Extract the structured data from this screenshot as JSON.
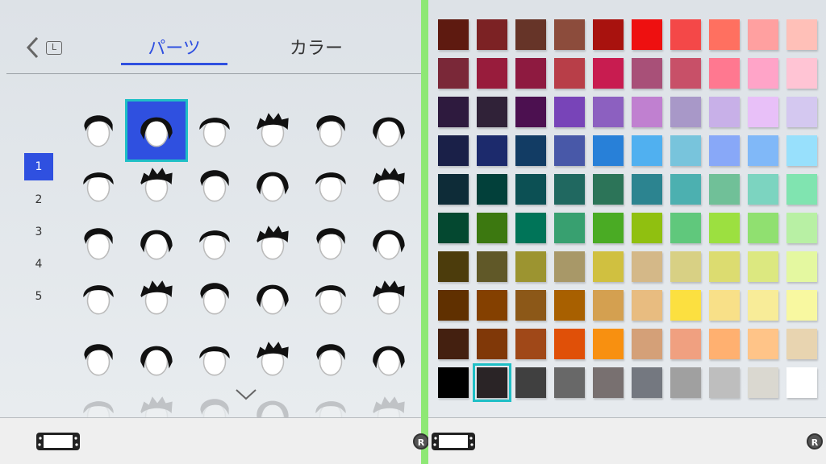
{
  "header": {
    "back_label": "L",
    "tabs": [
      {
        "label": "パーツ",
        "active": true
      },
      {
        "label": "カラー",
        "active": false
      }
    ]
  },
  "pages": {
    "items": [
      "1",
      "2",
      "3",
      "4",
      "5"
    ],
    "active": "1"
  },
  "hairstyles": {
    "selected_index": 1,
    "styles": [
      "short-bowl",
      "bob-selected",
      "short-crop",
      "spiky-short",
      "spiky-long",
      "swept",
      "side-part-left",
      "side-part-small",
      "side-part-right",
      "swoop-right",
      "middle-part",
      "widow-peak",
      "flat-top",
      "long-bob",
      "pompadour",
      "spiky-top",
      "swept-back",
      "messy-spiky",
      "curly-short",
      "curly-volume",
      "curly-side",
      "curly-top",
      "curly-wide",
      "curly-round",
      "afro-spiky",
      "long-side",
      "long-straight",
      "spiky-mid",
      "long-middle",
      "long-round"
    ]
  },
  "palette": {
    "selected_row": 9,
    "selected_col": 1,
    "rows": [
      [
        "#5e1a10",
        "#7c2224",
        "#663428",
        "#8c4c3c",
        "#a8120e",
        "#ee1010",
        "#f44848",
        "#ff7060",
        "#ffa0a0",
        "#ffc0b8"
      ],
      [
        "#7a2838",
        "#981c3c",
        "#8e1a40",
        "#b83e48",
        "#c81c50",
        "#a85078",
        "#c85068",
        "#ff7890",
        "#ffa4c8",
        "#ffc4d4"
      ],
      [
        "#2e1a3e",
        "#302238",
        "#4c1050",
        "#7844b8",
        "#8c60c0",
        "#c080d0",
        "#a898c8",
        "#c8b0e8",
        "#e8c0f8",
        "#d4c8f0"
      ],
      [
        "#1a2048",
        "#1c2a6c",
        "#123c64",
        "#4858a8",
        "#2880d8",
        "#50b0f0",
        "#78c4dc",
        "#88a8f8",
        "#80b8f8",
        "#98e0fc"
      ],
      [
        "#0e2c38",
        "#02403a",
        "#0c5054",
        "#206860",
        "#2c7458",
        "#2c8490",
        "#4cb0b0",
        "#70c098",
        "#7cd4c0",
        "#80e4b0"
      ],
      [
        "#044830",
        "#3c7810",
        "#007458",
        "#38a070",
        "#4aab24",
        "#90c010",
        "#60c87c",
        "#9ce040",
        "#90e070",
        "#b8f0a4"
      ],
      [
        "#4c3c0c",
        "#605828",
        "#9c9430",
        "#a89868",
        "#d0c040",
        "#d4b888",
        "#d8d084",
        "#dcdc70",
        "#dce880",
        "#e4f8a0"
      ],
      [
        "#603000",
        "#844000",
        "#8c5818",
        "#a86000",
        "#d4a050",
        "#e8bc80",
        "#fce040",
        "#f8e088",
        "#f8ec98",
        "#f8f8a0"
      ],
      [
        "#442010",
        "#803808",
        "#a04818",
        "#e05008",
        "#f89010",
        "#d4a078",
        "#f0a080",
        "#ffb070",
        "#ffc488",
        "#e8d4b0"
      ],
      [
        "#000000",
        "#2a2426",
        "#404040",
        "#686868",
        "#787070",
        "#747880",
        "#a0a0a0",
        "#bebebe",
        "#dad8d0",
        "#ffffff"
      ]
    ]
  },
  "footer": {
    "left_button": "R",
    "right_button": "R"
  }
}
